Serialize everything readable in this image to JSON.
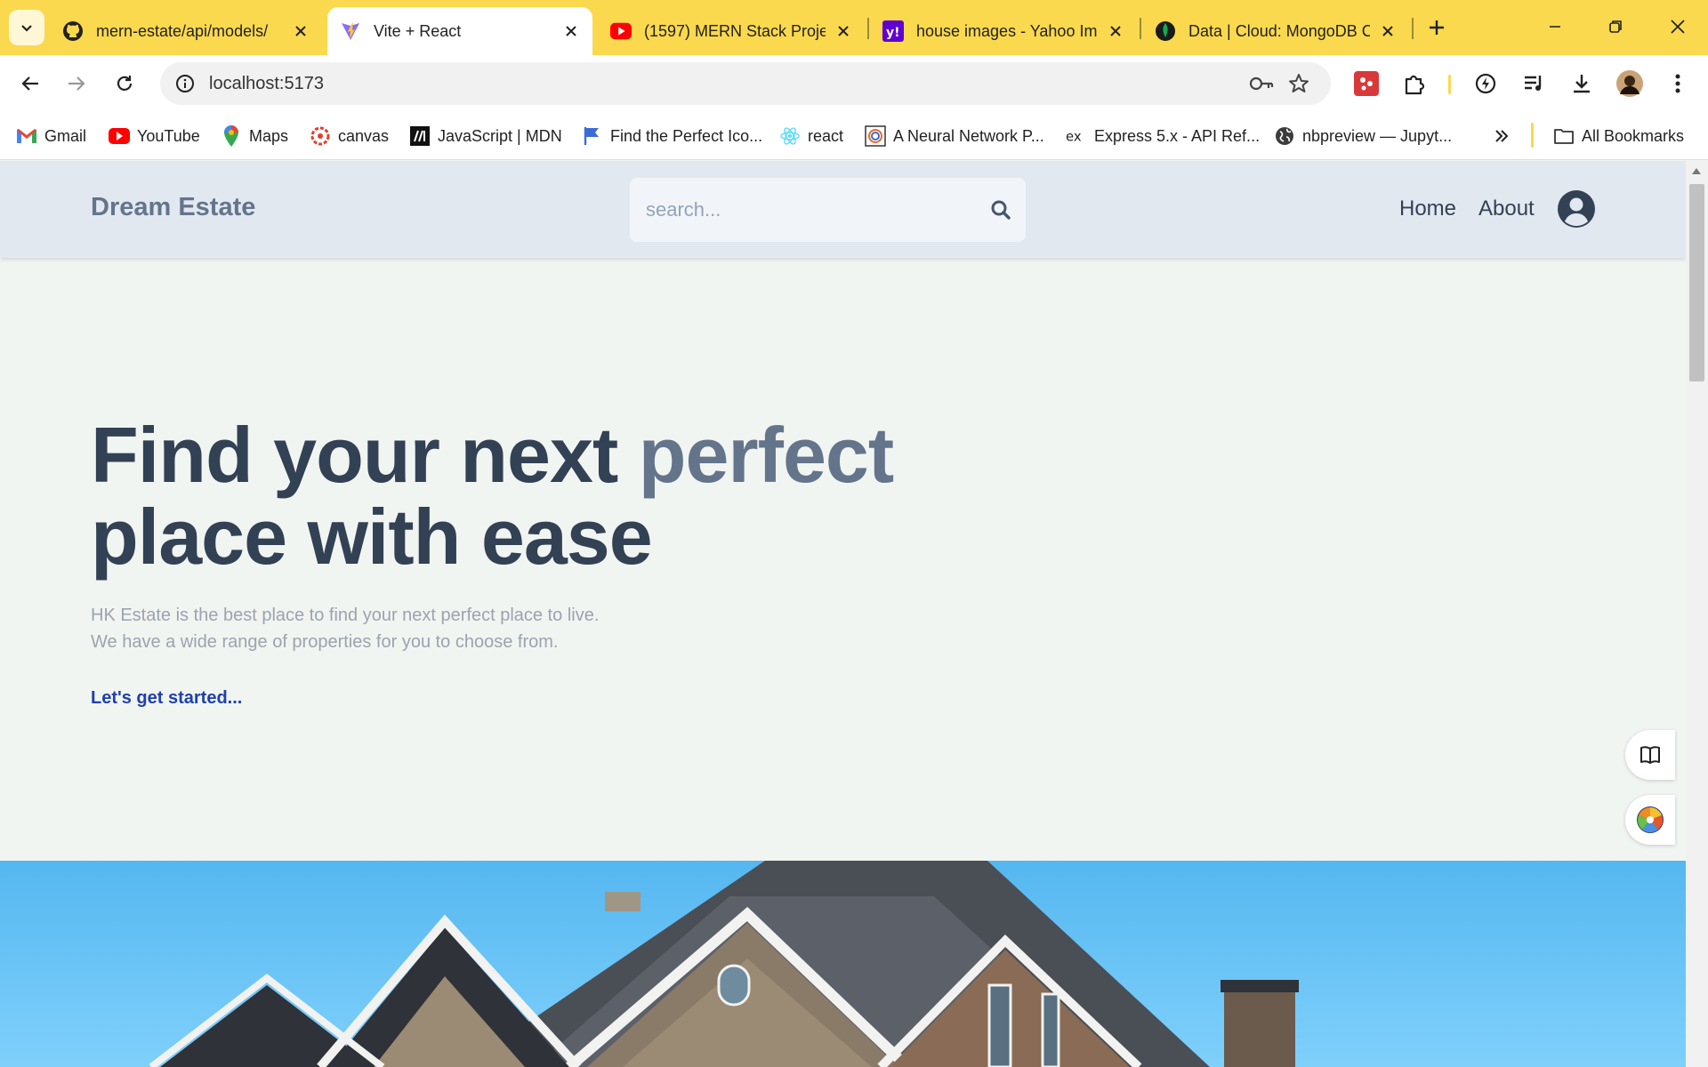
{
  "browser": {
    "tabs": [
      {
        "title": "mern-estate/api/models/",
        "favicon": "github-icon",
        "active": false
      },
      {
        "title": "Vite + React",
        "favicon": "vite-icon",
        "active": true
      },
      {
        "title": "(1597) MERN Stack Proje",
        "favicon": "youtube-icon",
        "active": false
      },
      {
        "title": "house images - Yahoo Ima",
        "favicon": "yahoo-icon",
        "active": false
      },
      {
        "title": "Data | Cloud: MongoDB C",
        "favicon": "mongodb-icon",
        "active": false
      }
    ],
    "url": "localhost:5173",
    "bookmarks": [
      {
        "label": "Gmail",
        "icon": "gmail-icon"
      },
      {
        "label": "YouTube",
        "icon": "youtube-icon"
      },
      {
        "label": "Maps",
        "icon": "maps-icon"
      },
      {
        "label": "canvas",
        "icon": "canvas-icon"
      },
      {
        "label": "JavaScript | MDN",
        "icon": "mdn-icon"
      },
      {
        "label": "Find the Perfect Ico...",
        "icon": "flag-icon"
      },
      {
        "label": "react",
        "icon": "react-icon"
      },
      {
        "label": "A Neural Network P...",
        "icon": "spiral-icon"
      },
      {
        "label": "Express 5.x - API Ref...",
        "icon": "express-icon"
      },
      {
        "label": "nbpreview — Jupyt...",
        "icon": "globe-icon"
      }
    ],
    "all_bookmarks_label": "All Bookmarks",
    "chrome_color": "#fbd94e"
  },
  "site": {
    "logo": "Dream Estate",
    "search_placeholder": "search...",
    "nav": {
      "home": "Home",
      "about": "About"
    },
    "hero": {
      "title_part1": "Find your next ",
      "title_accent": "perfect",
      "title_line2": "place with ease",
      "subtitle_line1": "HK Estate is the best place to find your next perfect place to live.",
      "subtitle_line2": "We have a wide range of properties for you to choose from.",
      "cta": "Let's get started..."
    },
    "colors": {
      "header_bg": "#e2e8f0",
      "title": "#334155",
      "accent": "#64748b",
      "cta": "#1e40af"
    }
  }
}
